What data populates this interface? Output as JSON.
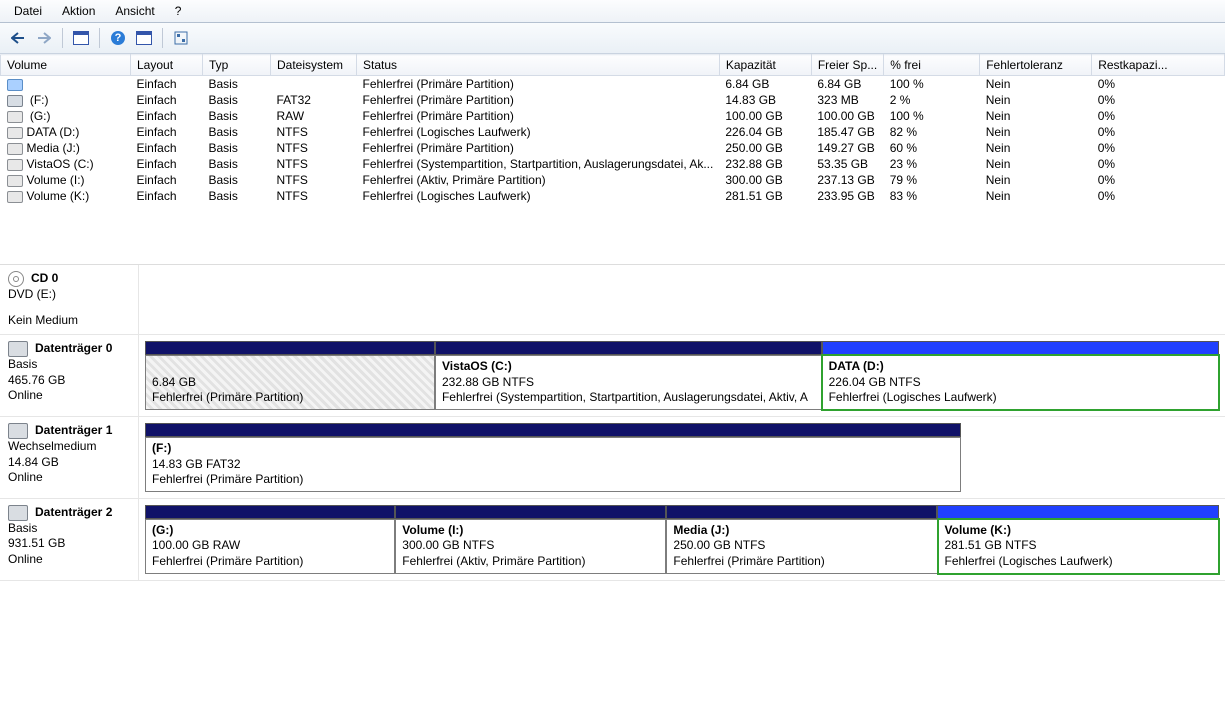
{
  "menu": {
    "file": "Datei",
    "action": "Aktion",
    "view": "Ansicht",
    "help": "?"
  },
  "columns": {
    "volume": "Volume",
    "layout": "Layout",
    "typ": "Typ",
    "fs": "Dateisystem",
    "status": "Status",
    "cap": "Kapazität",
    "free": "Freier Sp...",
    "pct": "% frei",
    "fault": "Fehlertoleranz",
    "rest": "Restkapazi..."
  },
  "volumes": [
    {
      "name": "",
      "icon": "blue",
      "layout": "Einfach",
      "typ": "Basis",
      "fs": "",
      "status": "Fehlerfrei (Primäre Partition)",
      "cap": "6.84 GB",
      "free": "6.84 GB",
      "pct": "100 %",
      "fault": "Nein",
      "rest": "0%"
    },
    {
      "name": " (F:)",
      "icon": "usb",
      "layout": "Einfach",
      "typ": "Basis",
      "fs": "FAT32",
      "status": "Fehlerfrei (Primäre Partition)",
      "cap": "14.83 GB",
      "free": "323 MB",
      "pct": "2 %",
      "fault": "Nein",
      "rest": "0%"
    },
    {
      "name": " (G:)",
      "icon": "",
      "layout": "Einfach",
      "typ": "Basis",
      "fs": "RAW",
      "status": "Fehlerfrei (Primäre Partition)",
      "cap": "100.00 GB",
      "free": "100.00 GB",
      "pct": "100 %",
      "fault": "Nein",
      "rest": "0%"
    },
    {
      "name": "DATA (D:)",
      "icon": "",
      "layout": "Einfach",
      "typ": "Basis",
      "fs": "NTFS",
      "status": "Fehlerfrei (Logisches Laufwerk)",
      "cap": "226.04 GB",
      "free": "185.47 GB",
      "pct": "82 %",
      "fault": "Nein",
      "rest": "0%"
    },
    {
      "name": "Media (J:)",
      "icon": "",
      "layout": "Einfach",
      "typ": "Basis",
      "fs": "NTFS",
      "status": "Fehlerfrei (Primäre Partition)",
      "cap": "250.00 GB",
      "free": "149.27 GB",
      "pct": "60 %",
      "fault": "Nein",
      "rest": "0%"
    },
    {
      "name": "VistaOS (C:)",
      "icon": "",
      "layout": "Einfach",
      "typ": "Basis",
      "fs": "NTFS",
      "status": "Fehlerfrei (Systempartition, Startpartition, Auslagerungsdatei, Ak...",
      "cap": "232.88 GB",
      "free": "53.35 GB",
      "pct": "23 %",
      "fault": "Nein",
      "rest": "0%"
    },
    {
      "name": "Volume (I:)",
      "icon": "",
      "layout": "Einfach",
      "typ": "Basis",
      "fs": "NTFS",
      "status": "Fehlerfrei (Aktiv, Primäre Partition)",
      "cap": "300.00 GB",
      "free": "237.13 GB",
      "pct": "79 %",
      "fault": "Nein",
      "rest": "0%"
    },
    {
      "name": "Volume (K:)",
      "icon": "",
      "layout": "Einfach",
      "typ": "Basis",
      "fs": "NTFS",
      "status": "Fehlerfrei (Logisches Laufwerk)",
      "cap": "281.51 GB",
      "free": "233.95 GB",
      "pct": "83 %",
      "fault": "Nein",
      "rest": "0%"
    }
  ],
  "cd": {
    "title": "CD 0",
    "line2": "DVD (E:)",
    "line3": "Kein Medium"
  },
  "disk0": {
    "title": "Datenträger 0",
    "type": "Basis",
    "size": "465.76 GB",
    "state": "Online",
    "p1": {
      "size": "6.84 GB",
      "status": "Fehlerfrei (Primäre Partition)"
    },
    "p2": {
      "name": "VistaOS  (C:)",
      "size": "232.88 GB NTFS",
      "status": "Fehlerfrei (Systempartition, Startpartition, Auslagerungsdatei, Aktiv, A"
    },
    "p3": {
      "name": "DATA  (D:)",
      "size": "226.04 GB NTFS",
      "status": "Fehlerfrei (Logisches Laufwerk)"
    }
  },
  "disk1": {
    "title": "Datenträger 1",
    "type": "Wechselmedium",
    "size": "14.84 GB",
    "state": "Online",
    "p1": {
      "name": " (F:)",
      "size": "14.83 GB FAT32",
      "status": "Fehlerfrei (Primäre Partition)"
    }
  },
  "disk2": {
    "title": "Datenträger 2",
    "type": "Basis",
    "size": "931.51 GB",
    "state": "Online",
    "p1": {
      "name": " (G:)",
      "size": "100.00 GB RAW",
      "status": "Fehlerfrei (Primäre Partition)"
    },
    "p2": {
      "name": "Volume  (I:)",
      "size": "300.00 GB NTFS",
      "status": "Fehlerfrei (Aktiv, Primäre Partition)"
    },
    "p3": {
      "name": "Media  (J:)",
      "size": "250.00 GB NTFS",
      "status": "Fehlerfrei (Primäre Partition)"
    },
    "p4": {
      "name": "Volume  (K:)",
      "size": "281.51 GB NTFS",
      "status": "Fehlerfrei (Logisches Laufwerk)"
    }
  }
}
